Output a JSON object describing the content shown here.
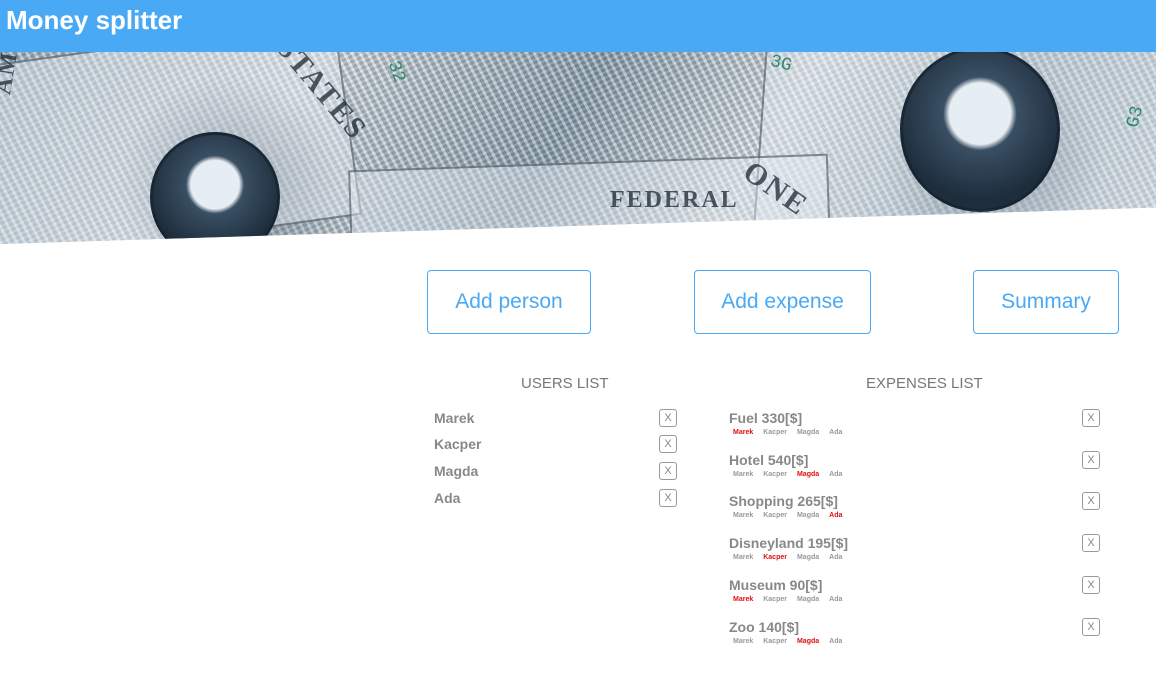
{
  "app": {
    "title": "Money splitter"
  },
  "hero": {
    "bill_texts": [
      "AMERICA",
      "STATES",
      "ONE",
      "FEDERAL"
    ],
    "serials": [
      "32",
      "3G",
      "G3"
    ]
  },
  "toolbar": {
    "add_person_label": "Add person",
    "add_expense_label": "Add expense",
    "summary_label": "Summary"
  },
  "users": {
    "title": "USERS LIST",
    "remove_label": "X",
    "items": [
      {
        "name": "Marek"
      },
      {
        "name": "Kacper"
      },
      {
        "name": "Magda"
      },
      {
        "name": "Ada"
      }
    ]
  },
  "expenses": {
    "title": "EXPENSES LIST",
    "remove_label": "X",
    "payer_color": "#e01010",
    "items": [
      {
        "label": "Fuel 330[$]",
        "people": [
          "Marek",
          "Kacper",
          "Magda",
          "Ada"
        ],
        "payer": "Marek"
      },
      {
        "label": "Hotel 540[$]",
        "people": [
          "Marek",
          "Kacper",
          "Magda",
          "Ada"
        ],
        "payer": "Magda"
      },
      {
        "label": "Shopping 265[$]",
        "people": [
          "Marek",
          "Kacper",
          "Magda",
          "Ada"
        ],
        "payer": "Ada"
      },
      {
        "label": "Disneyland 195[$]",
        "people": [
          "Marek",
          "Kacper",
          "Magda",
          "Ada"
        ],
        "payer": "Kacper"
      },
      {
        "label": "Museum 90[$]",
        "people": [
          "Marek",
          "Kacper",
          "Magda",
          "Ada"
        ],
        "payer": "Marek"
      },
      {
        "label": "Zoo 140[$]",
        "people": [
          "Marek",
          "Kacper",
          "Magda",
          "Ada"
        ],
        "payer": "Magda"
      }
    ]
  }
}
